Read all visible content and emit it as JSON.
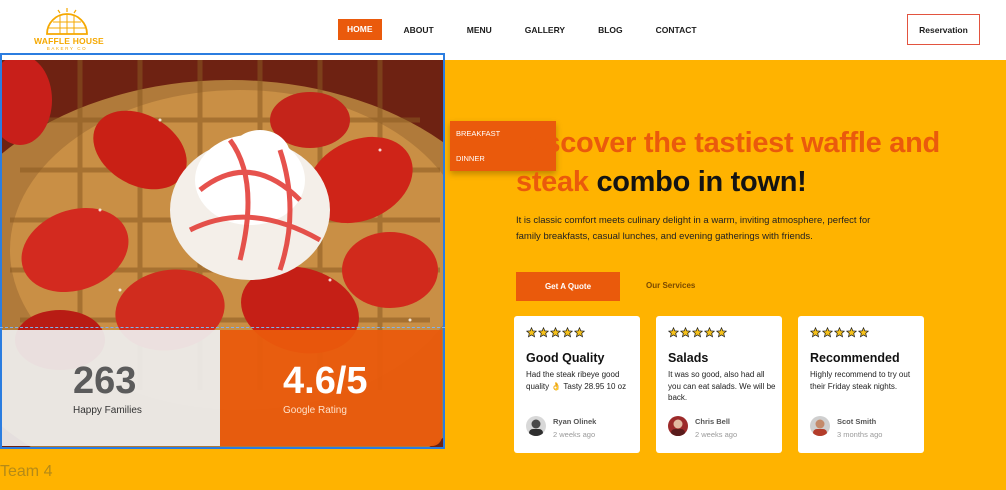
{
  "header": {
    "logo": {
      "name": "WAFFLE HOUSE",
      "tagline": "BAKERY CO",
      "color": "#f5a800"
    },
    "nav": [
      {
        "label": "HOME",
        "active": true
      },
      {
        "label": "ABOUT",
        "active": false
      },
      {
        "label": "MENU",
        "active": false
      },
      {
        "label": "GALLERY",
        "active": false
      },
      {
        "label": "BLOG",
        "active": false
      },
      {
        "label": "CONTACT",
        "active": false
      }
    ],
    "reservation_label": "Reservation"
  },
  "dropdown": {
    "items": [
      "BREAKFAST",
      "DINNER"
    ]
  },
  "hero": {
    "headline_orange": "Discover the tastiest waffle and steak",
    "headline_dark": "combo in town!",
    "description": "It is classic comfort meets culinary delight in a warm, inviting atmosphere, perfect for family breakfasts, casual lunches, and evening gatherings with friends.",
    "primary_button": "Get A Quote",
    "secondary_link": "Our Services",
    "background_color": "#ffb300",
    "accent_color": "#ea5a0c"
  },
  "stats": [
    {
      "value": "263",
      "label": "Happy Families"
    },
    {
      "value": "4.6/5",
      "label": "Google Rating"
    }
  ],
  "team_label": "Team 4",
  "testimonials": [
    {
      "rating": 5,
      "title": "Good Quality",
      "body": "Had the steak ribeye good quality 👌 Tasty 28.95 10 oz",
      "name": "Ryan Olinek",
      "time": "2 weeks ago"
    },
    {
      "rating": 5,
      "title": "Salads",
      "body": "It was so good, also had all you can eat salads. We will be back.",
      "name": "Chris Bell",
      "time": "2  weeks ago"
    },
    {
      "rating": 5,
      "title": "Recommended",
      "body": "Highly recommend to try out their Friday steak nights.",
      "name": "Scot Smith",
      "time": "3 months ago"
    }
  ]
}
